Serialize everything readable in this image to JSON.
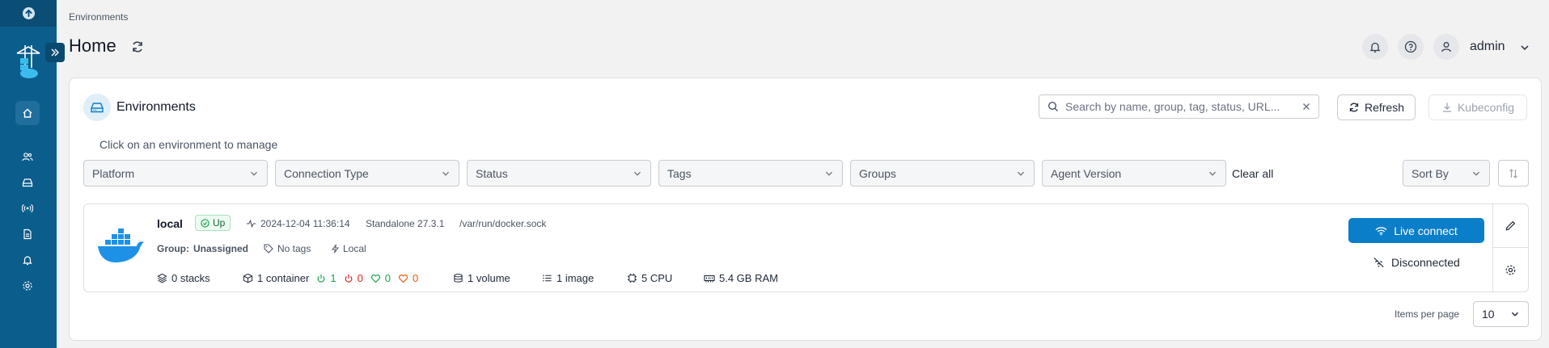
{
  "header": {
    "breadcrumb": "Environments",
    "title": "Home",
    "user": "admin"
  },
  "widget": {
    "title": "Environments",
    "search_placeholder": "Search by name, group, tag, status, URL...",
    "refresh_label": "Refresh",
    "kubeconfig_label": "Kubeconfig",
    "hint": "Click on an environment to manage"
  },
  "filters": [
    {
      "label": "Platform"
    },
    {
      "label": "Connection Type"
    },
    {
      "label": "Status"
    },
    {
      "label": "Tags"
    },
    {
      "label": "Groups"
    },
    {
      "label": "Agent Version"
    }
  ],
  "clear_all": "Clear all",
  "sort_by": "Sort By",
  "environment": {
    "name": "local",
    "status": "Up",
    "timestamp": "2024-12-04 11:36:14",
    "type": "Standalone 27.3.1",
    "url": "/var/run/docker.sock",
    "group_label": "Group:",
    "group_value": "Unassigned",
    "tags": "No tags",
    "locality": "Local",
    "stacks": "0 stacks",
    "containers": "1 container",
    "running": "1",
    "stopped": "0",
    "healthy": "0",
    "unhealthy": "0",
    "volumes": "1 volume",
    "images": "1 image",
    "cpu": "5 CPU",
    "ram": "5.4 GB RAM",
    "live_connect": "Live connect",
    "connection_state": "Disconnected"
  },
  "pagination": {
    "items_per_page_label": "Items per page",
    "items_per_page_value": "10"
  },
  "colors": {
    "sidebar": "#0b5d8c",
    "primary": "#0b7ec9",
    "running": "#16a34a",
    "stopped": "#dc2626",
    "healthy": "#16a34a",
    "unhealthy": "#ea580c"
  }
}
